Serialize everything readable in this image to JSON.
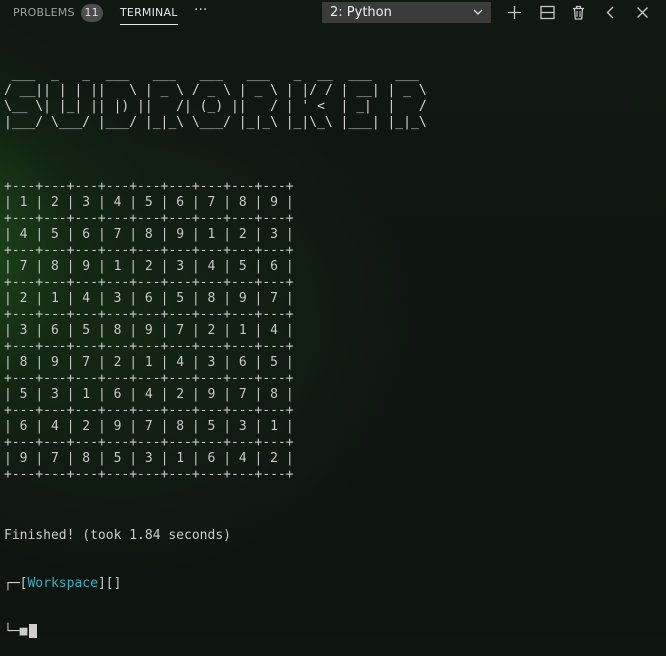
{
  "panel": {
    "tabs": [
      {
        "label": "PROBLEMS",
        "badge": "11"
      },
      {
        "label": "TERMINAL"
      }
    ],
    "more_label": "···",
    "terminal_select": {
      "value": "2: Python"
    },
    "icons": [
      "plus-icon",
      "split-icon",
      "trash-icon",
      "chevron-left-icon",
      "close-icon"
    ],
    "colors": {
      "background": "#0f1510",
      "select_bg": "#3b3b3b",
      "workspace": "#2fb2c0",
      "text": "#cccccc"
    }
  },
  "terminal": {
    "ascii_art": [
      " ___  _   _  ___   ___   ___   ___   _  __  ___   ___",
      "/ __|| | | ||   \\ | _ \\ / _ \\ | _ \\ | |/ / | __| | _ \\",
      "\\__ \\| |_| || |) ||   /| (_) ||   / | ' <  | _|  |   /",
      "|___/ \\___/ |___/ |_|_\\ \\___/ |_|_\\ |_|\\_\\ |___| |_|_\\"
    ],
    "sudoku_rows": [
      [
        "1",
        "2",
        "3",
        "4",
        "5",
        "6",
        "7",
        "8",
        "9"
      ],
      [
        "4",
        "5",
        "6",
        "7",
        "8",
        "9",
        "1",
        "2",
        "3"
      ],
      [
        "7",
        "8",
        "9",
        "1",
        "2",
        "3",
        "4",
        "5",
        "6"
      ],
      [
        "2",
        "1",
        "4",
        "3",
        "6",
        "5",
        "8",
        "9",
        "7"
      ],
      [
        "3",
        "6",
        "5",
        "8",
        "9",
        "7",
        "2",
        "1",
        "4"
      ],
      [
        "8",
        "9",
        "7",
        "2",
        "1",
        "4",
        "3",
        "6",
        "5"
      ],
      [
        "5",
        "3",
        "1",
        "6",
        "4",
        "2",
        "9",
        "7",
        "8"
      ],
      [
        "6",
        "4",
        "2",
        "9",
        "7",
        "8",
        "5",
        "3",
        "1"
      ],
      [
        "9",
        "7",
        "8",
        "5",
        "3",
        "1",
        "6",
        "4",
        "2"
      ]
    ],
    "finished_line": "Finished! (took 1.84 seconds)",
    "prompt": {
      "prefix": "┌─[",
      "workspace": "Workspace",
      "suffix": "][]",
      "second_line": "└─■"
    }
  }
}
